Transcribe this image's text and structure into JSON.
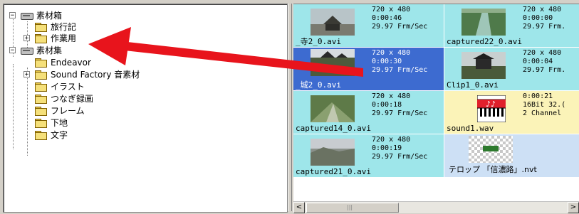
{
  "tree": {
    "items": [
      {
        "label": "素材箱",
        "expander": "−",
        "icon": "drive"
      },
      {
        "label": "旅行記",
        "expander": "",
        "icon": "folder"
      },
      {
        "label": "作業用",
        "expander": "+",
        "icon": "folder-open"
      },
      {
        "label": "素材集",
        "expander": "−",
        "icon": "drive"
      },
      {
        "label": "Endeavor",
        "expander": "",
        "icon": "folder"
      },
      {
        "label": "Sound Factory 音素材",
        "expander": "+",
        "icon": "folder"
      },
      {
        "label": "イラスト",
        "expander": "",
        "icon": "folder"
      },
      {
        "label": "つなぎ録画",
        "expander": "",
        "icon": "folder"
      },
      {
        "label": "フレーム",
        "expander": "",
        "icon": "folder"
      },
      {
        "label": "下地",
        "expander": "",
        "icon": "folder"
      },
      {
        "label": "文字",
        "expander": "",
        "icon": "folder"
      }
    ]
  },
  "clips": [
    {
      "kind": "video",
      "info": "720 x 480\n0:00:46\n29.97 Frm/Sec",
      "filename": "_寺2_0.avi",
      "thumb": "temple"
    },
    {
      "kind": "video",
      "info": "720 x 480\n0:00:00\n29.97 Frm.",
      "filename": "captured22_0.avi",
      "thumb": "waterslide"
    },
    {
      "kind": "selected",
      "info": "720 x 480\n0:00:30\n29.97 Frm/Sec",
      "filename": "_城2_0.avi",
      "thumb": "castle"
    },
    {
      "kind": "video",
      "info": "720 x 480\n0:00:04\n29.97 Frm.",
      "filename": "Clip1_0.avi",
      "thumb": "building"
    },
    {
      "kind": "video",
      "info": "720 x 480\n0:00:18\n29.97 Frm/Sec",
      "filename": "captured14_0.avi",
      "thumb": "field"
    },
    {
      "kind": "audio",
      "info": "0:00:21\n16Bit 32.(\n2 Channel",
      "filename": "sound1.wav",
      "thumb": "music"
    },
    {
      "kind": "video",
      "info": "720 x 480\n0:00:19\n29.97 Frm/Sec",
      "filename": "captured21_0.avi",
      "thumb": "landscape"
    },
    {
      "kind": "telop",
      "info": "",
      "filename": "テロップ 「信濃路」.nvt",
      "thumb": "telop"
    }
  ],
  "scrollbar": {
    "left_arrow": "<",
    "right_arrow": ">"
  },
  "colors": {
    "arrow": "#e8141c",
    "video_cell": "#9ee6ea",
    "selected_cell": "#3d6bd0",
    "audio_cell": "#fbf3b8",
    "telop_cell": "#cde0f5"
  }
}
